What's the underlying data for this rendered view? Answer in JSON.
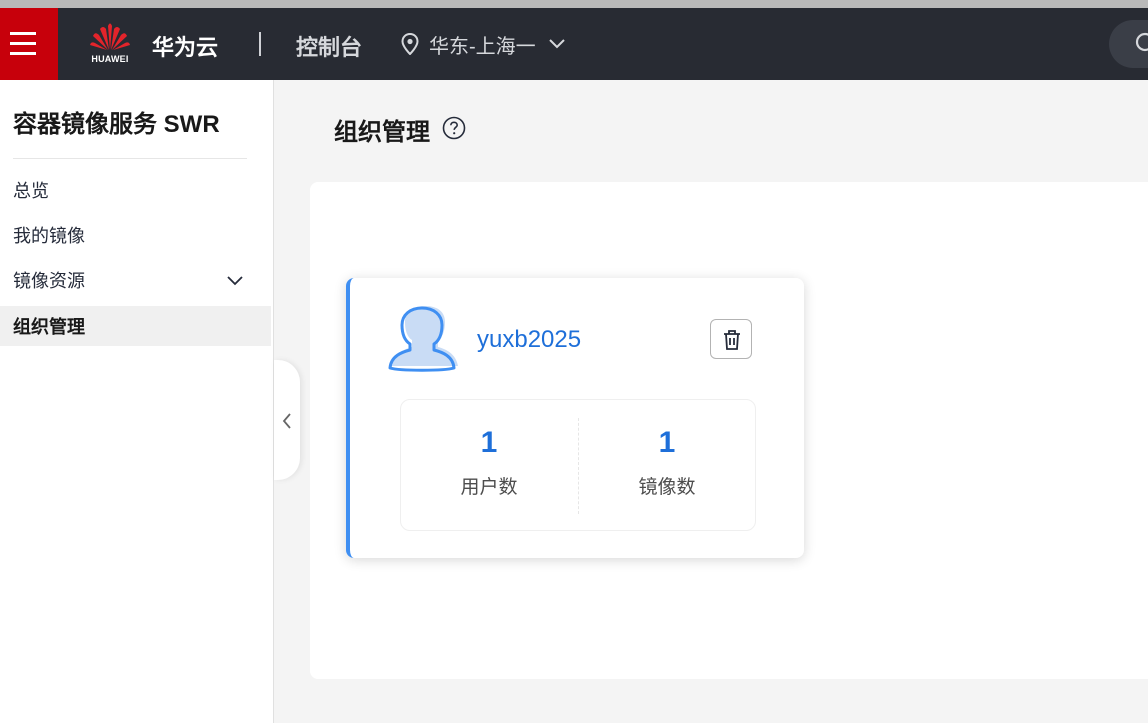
{
  "header": {
    "logo_text": "HUAWEI",
    "brand": "华为云",
    "console": "控制台",
    "region": "华东-上海一"
  },
  "sidebar": {
    "title": "容器镜像服务 SWR",
    "items": [
      {
        "label": "总览"
      },
      {
        "label": "我的镜像"
      },
      {
        "label": "镜像资源",
        "expandable": true
      },
      {
        "label": "组织管理",
        "active": true
      }
    ]
  },
  "main": {
    "title": "组织管理",
    "organizations": [
      {
        "name": "yuxb2025",
        "stats": [
          {
            "value": "1",
            "label": "用户数"
          },
          {
            "value": "1",
            "label": "镜像数"
          }
        ]
      }
    ]
  },
  "colors": {
    "brand_red": "#c7000b",
    "topbar_bg": "#282b33",
    "link_blue": "#1e6fd9",
    "card_accent": "#3f8ff2"
  },
  "icons": {
    "menu": "hamburger-icon",
    "region": "location-pin-icon",
    "region_dropdown": "chevron-down-icon",
    "search": "search-icon",
    "help": "question-circle-icon",
    "avatar": "user-icon",
    "delete": "trash-icon",
    "collapse": "chevron-left-icon"
  }
}
